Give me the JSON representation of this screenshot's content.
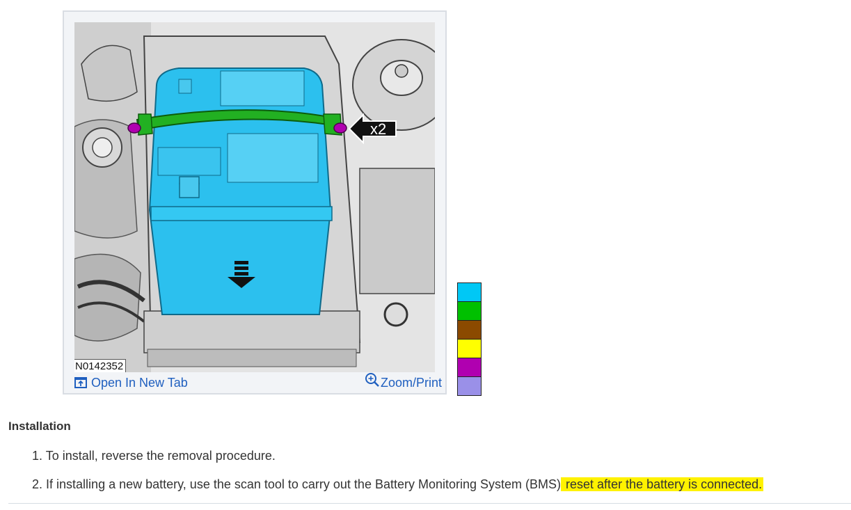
{
  "figure": {
    "id": "N0142352",
    "callout": "x2",
    "open_tab_label": "Open In New Tab",
    "zoom_label": "Zoom/Print"
  },
  "legend": {
    "colors": [
      "#00c8f5",
      "#00c000",
      "#8b4a00",
      "#ffff00",
      "#b000b0",
      "#9a90e8"
    ]
  },
  "installation": {
    "heading": "Installation",
    "steps": [
      {
        "number": "1.",
        "text": "To install, reverse the removal procedure."
      },
      {
        "number": "2.",
        "text_before": "If installing a new battery, use the scan tool to carry out the Battery Monitoring System (BMS)",
        "text_highlight": " reset after the battery is connected."
      }
    ]
  },
  "colors": {
    "battery": "#2cc0ee",
    "strap": "#22b022",
    "bolt": "#b000b0",
    "link": "#1f5fbf",
    "highlight": "#fff200"
  }
}
